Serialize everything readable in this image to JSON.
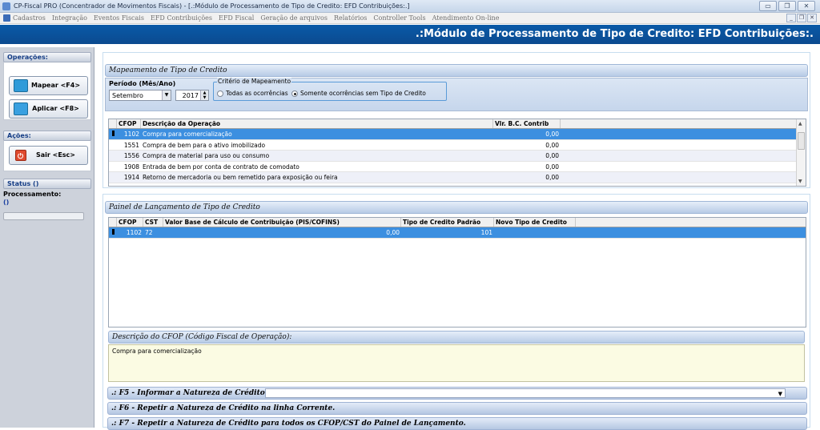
{
  "window": {
    "title": "CP-Fiscal PRO (Concentrador de Movimentos Fiscais) - [.:Módulo de Processamento de Tipo de Credito: EFD Contribuições:.]"
  },
  "menu": {
    "items": [
      "Cadastros",
      "Integração",
      "Eventos Fiscais",
      "EFD Contribuições",
      "EFD Fiscal",
      "Geração de arquivos",
      "Relatórios",
      "Controller Tools",
      "Atendimento On-line"
    ]
  },
  "header": {
    "title": ".:Módulo de Processamento de Tipo de Credito: EFD Contribuições:."
  },
  "sidebar": {
    "operacoes": {
      "label": "Operações:",
      "mapear": "Mapear <F4>",
      "aplicar": "Aplicar <F8>"
    },
    "acoes": {
      "label": "Ações:",
      "sair": "Sair <Esc>"
    },
    "status": {
      "label": "Status ()",
      "processamento_label": "Processamento:",
      "processamento_value": "()"
    }
  },
  "mapeamento": {
    "title": "Mapeamento de Tipo de Credito",
    "periodo_label": "Período (Mês/Ano)",
    "mes": "Setembro",
    "ano": "2017",
    "criterio_label": "Critério de Mapeamento",
    "radio1": "Todas as ocorrências",
    "radio2": "Somente ocorrências sem Tipo de Credito",
    "selected_radio": 2,
    "columns": [
      "CFOP",
      "Descrição da Operação",
      "Vlr. B.C. Contrib"
    ],
    "rows": [
      {
        "cfop": "1102",
        "desc": "Compra para comercialização",
        "valor": "0,00"
      },
      {
        "cfop": "1551",
        "desc": "Compra de bem para o ativo imobilizado",
        "valor": "0,00"
      },
      {
        "cfop": "1556",
        "desc": "Compra de material para uso ou consumo",
        "valor": "0,00"
      },
      {
        "cfop": "1908",
        "desc": "Entrada de bem por conta de contrato de comodato",
        "valor": "0,00"
      },
      {
        "cfop": "1914",
        "desc": "Retorno de mercadoria ou bem remetido para exposição ou feira",
        "valor": "0,00"
      }
    ]
  },
  "lancamento": {
    "title": "Painel de Lançamento de Tipo de Credito",
    "columns": [
      "CFOP",
      "CST",
      "Valor Base de Cálculo de Contribuição (PIS/COFINS)",
      "Tipo de Credito Padrão",
      "Novo Tipo de Credito"
    ],
    "rows": [
      {
        "cfop": "1102",
        "cst": "72",
        "valor": "0,00",
        "tipo_padrao": "101",
        "novo_tipo": ""
      }
    ]
  },
  "descricao": {
    "title": "Descrição do CFOP (Código Fiscal de Operação):",
    "text": "Compra para comercialização"
  },
  "actions": {
    "f5": ".: F5 - Informar a Natureza de Crédito:",
    "f6": ".: F6 - Repetir a Natureza de Crédito na linha Corrente.",
    "f7": ".: F7 - Repetir a Natureza de Crédito para todos os CFOP/CST do Painel de Lançamento."
  },
  "colors": {
    "header_bg": "#0b4f9a",
    "selection": "#3c8fe0",
    "desc_bg": "#fbfbe3"
  }
}
